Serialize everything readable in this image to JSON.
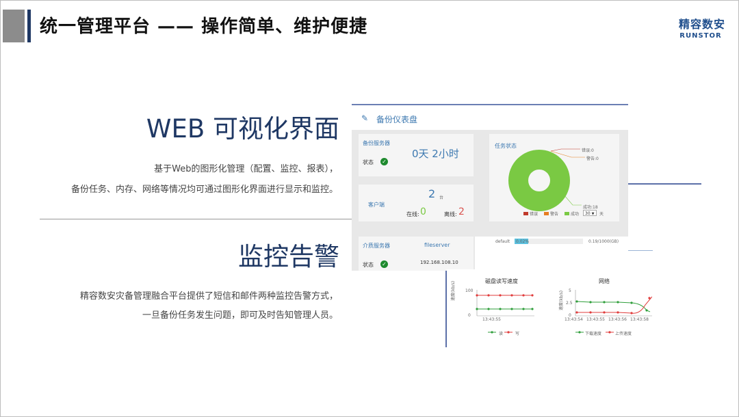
{
  "header": {
    "title": "统一管理平台 —— 操作简单、维护便捷",
    "logo_cn": "精容数安",
    "logo_en": "RUNSTOR"
  },
  "section1": {
    "heading": "WEB 可视化界面",
    "line1": "基于Web的图形化管理（配置、监控、报表），",
    "line2": "备份任务、内存、网络等情况均可通过图形化界面进行显示和监控。"
  },
  "section2": {
    "heading": "监控告警",
    "line1": "精容数安灾备管理融合平台提供了短信和邮件两种监控告警方式，",
    "line2": "一旦备份任务发生问题，即可及时告知管理人员。"
  },
  "dashboard": {
    "title": "备份仪表盘",
    "backup_server": {
      "label": "备份服务器",
      "uptime": "0天 2小时",
      "status_label": "状态"
    },
    "task_status": {
      "label": "任务状态",
      "legend": [
        "错误",
        "警告",
        "成功"
      ],
      "legend_colors": [
        "#c0392b",
        "#e67e22",
        "#7ac943"
      ],
      "callouts": [
        "错误:0",
        "警告:0",
        "成功:18"
      ],
      "days_value": "30",
      "days_unit": "天",
      "pie": [
        {
          "name": "错误",
          "value": 0,
          "color": "#c0392b"
        },
        {
          "name": "警告",
          "value": 0,
          "color": "#e67e22"
        },
        {
          "name": "成功",
          "value": 18,
          "color": "#7ac943"
        }
      ]
    },
    "clients": {
      "label": "客户端",
      "count": "2",
      "unit": "台",
      "online_label": "在线:",
      "online": "0",
      "offline_label": "离线:",
      "offline": "2"
    },
    "media_server": {
      "label": "介质服务器",
      "name": "fileserver",
      "ip": "192.168.108.10",
      "status_label": "状态"
    },
    "storage": {
      "name": "default",
      "percent": "0.02%",
      "usage": "0.19/1000(GB)",
      "fill_fraction": 0.02
    }
  },
  "charts": {
    "disk": {
      "title": "磁盘读写速度",
      "ylabel": "速度(kb/s)",
      "y_max": "100",
      "y_min": "0",
      "x_tick": "13:43:55",
      "legend": [
        "读",
        "写"
      ]
    },
    "network": {
      "title": "网络",
      "ylabel": "速度(kb/s)",
      "y_ticks": [
        "5",
        "2.5",
        "0"
      ],
      "x_ticks": [
        "13:43:54",
        "13:43:55",
        "13:43:56",
        "13:43:58"
      ],
      "legend": [
        "下载速度",
        "上传速度"
      ]
    },
    "colors": {
      "read": "#2e9e3a",
      "write": "#e03b3b"
    }
  }
}
